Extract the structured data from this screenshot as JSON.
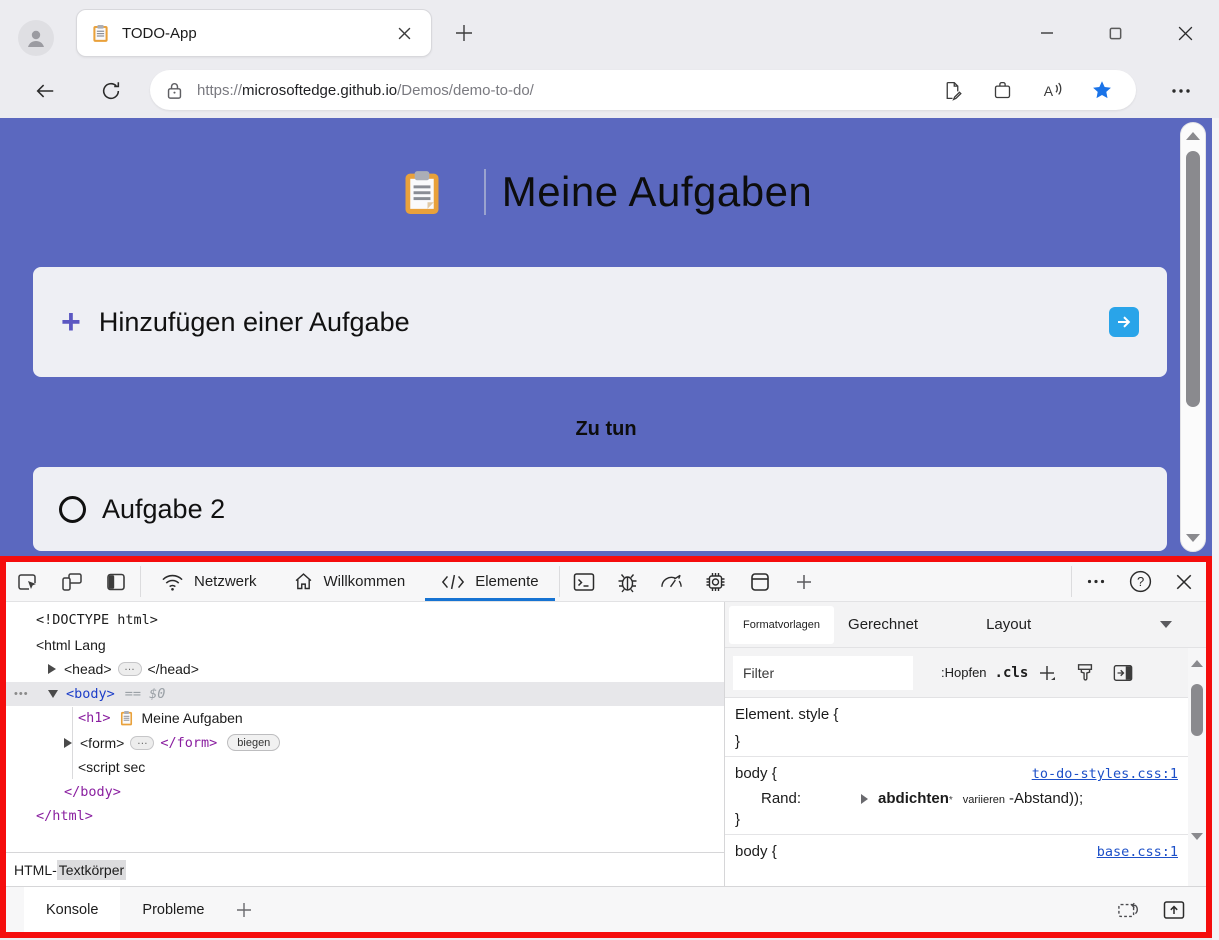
{
  "browser": {
    "tab_title": "TODO-App",
    "url_scheme": "https://",
    "url_domain": "microsoftedge.github.io",
    "url_path": "/Demos/demo-to-do/"
  },
  "page": {
    "title": "Meine Aufgaben",
    "add_label": "Hinzufügen einer Aufgabe",
    "plus": "+",
    "section_label": "Zu tun",
    "task_label": "Aufgabe 2"
  },
  "devtools": {
    "tabs": {
      "network": "Netzwerk",
      "welcome": "Willkommen",
      "elements": "Elemente"
    },
    "dom": {
      "doctype": "<!DOCTYPE html>",
      "html_open": "<html Lang",
      "head_open": "<head>",
      "head_close": "</head>",
      "dots": "•••",
      "more": "…",
      "body_open": "<body>",
      "body_eq": "== $0",
      "h1_open": "<h1>",
      "h1_text": "Meine Aufgaben",
      "form_open": "<form>",
      "form_close": "</form>",
      "form_badge": "biegen",
      "script_open": "<script sec",
      "body_close": "</body>",
      "html_close": "</html>"
    },
    "styles": {
      "tab_styles": "Formatvorlagen",
      "tab_computed": "Gerechnet",
      "tab_layout": "Layout",
      "filter_placeholder": "Filter",
      "pseudo_toggle": ":Hopfen",
      "cls_toggle": ".cls",
      "elem_style_open": "Element. style {",
      "brace_close": "}",
      "body_rule_open": "body {",
      "link1": "to-do-styles.css:1",
      "prop_name": "Rand:",
      "prop_value_bold": "abdichten",
      "prop_star": "*",
      "prop_value_small": "variieren",
      "prop_value_tail": "-Abstand));",
      "link2": "base.css:1"
    },
    "breadcrumb_html": "HTML-",
    "breadcrumb_body": "Textkörper",
    "drawer": {
      "console": "Konsole",
      "problems": "Probleme"
    }
  }
}
